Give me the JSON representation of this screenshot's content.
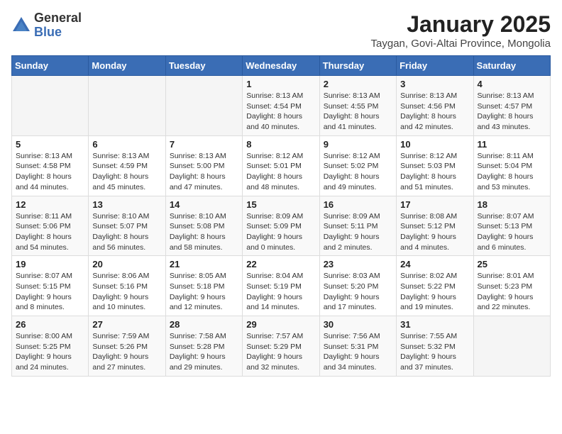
{
  "header": {
    "logo": {
      "line1": "General",
      "line2": "Blue"
    },
    "title": "January 2025",
    "subtitle": "Taygan, Govi-Altai Province, Mongolia"
  },
  "weekdays": [
    "Sunday",
    "Monday",
    "Tuesday",
    "Wednesday",
    "Thursday",
    "Friday",
    "Saturday"
  ],
  "weeks": [
    [
      {
        "day": "",
        "info": ""
      },
      {
        "day": "",
        "info": ""
      },
      {
        "day": "",
        "info": ""
      },
      {
        "day": "1",
        "info": "Sunrise: 8:13 AM\nSunset: 4:54 PM\nDaylight: 8 hours\nand 40 minutes."
      },
      {
        "day": "2",
        "info": "Sunrise: 8:13 AM\nSunset: 4:55 PM\nDaylight: 8 hours\nand 41 minutes."
      },
      {
        "day": "3",
        "info": "Sunrise: 8:13 AM\nSunset: 4:56 PM\nDaylight: 8 hours\nand 42 minutes."
      },
      {
        "day": "4",
        "info": "Sunrise: 8:13 AM\nSunset: 4:57 PM\nDaylight: 8 hours\nand 43 minutes."
      }
    ],
    [
      {
        "day": "5",
        "info": "Sunrise: 8:13 AM\nSunset: 4:58 PM\nDaylight: 8 hours\nand 44 minutes."
      },
      {
        "day": "6",
        "info": "Sunrise: 8:13 AM\nSunset: 4:59 PM\nDaylight: 8 hours\nand 45 minutes."
      },
      {
        "day": "7",
        "info": "Sunrise: 8:13 AM\nSunset: 5:00 PM\nDaylight: 8 hours\nand 47 minutes."
      },
      {
        "day": "8",
        "info": "Sunrise: 8:12 AM\nSunset: 5:01 PM\nDaylight: 8 hours\nand 48 minutes."
      },
      {
        "day": "9",
        "info": "Sunrise: 8:12 AM\nSunset: 5:02 PM\nDaylight: 8 hours\nand 49 minutes."
      },
      {
        "day": "10",
        "info": "Sunrise: 8:12 AM\nSunset: 5:03 PM\nDaylight: 8 hours\nand 51 minutes."
      },
      {
        "day": "11",
        "info": "Sunrise: 8:11 AM\nSunset: 5:04 PM\nDaylight: 8 hours\nand 53 minutes."
      }
    ],
    [
      {
        "day": "12",
        "info": "Sunrise: 8:11 AM\nSunset: 5:06 PM\nDaylight: 8 hours\nand 54 minutes."
      },
      {
        "day": "13",
        "info": "Sunrise: 8:10 AM\nSunset: 5:07 PM\nDaylight: 8 hours\nand 56 minutes."
      },
      {
        "day": "14",
        "info": "Sunrise: 8:10 AM\nSunset: 5:08 PM\nDaylight: 8 hours\nand 58 minutes."
      },
      {
        "day": "15",
        "info": "Sunrise: 8:09 AM\nSunset: 5:09 PM\nDaylight: 9 hours\nand 0 minutes."
      },
      {
        "day": "16",
        "info": "Sunrise: 8:09 AM\nSunset: 5:11 PM\nDaylight: 9 hours\nand 2 minutes."
      },
      {
        "day": "17",
        "info": "Sunrise: 8:08 AM\nSunset: 5:12 PM\nDaylight: 9 hours\nand 4 minutes."
      },
      {
        "day": "18",
        "info": "Sunrise: 8:07 AM\nSunset: 5:13 PM\nDaylight: 9 hours\nand 6 minutes."
      }
    ],
    [
      {
        "day": "19",
        "info": "Sunrise: 8:07 AM\nSunset: 5:15 PM\nDaylight: 9 hours\nand 8 minutes."
      },
      {
        "day": "20",
        "info": "Sunrise: 8:06 AM\nSunset: 5:16 PM\nDaylight: 9 hours\nand 10 minutes."
      },
      {
        "day": "21",
        "info": "Sunrise: 8:05 AM\nSunset: 5:18 PM\nDaylight: 9 hours\nand 12 minutes."
      },
      {
        "day": "22",
        "info": "Sunrise: 8:04 AM\nSunset: 5:19 PM\nDaylight: 9 hours\nand 14 minutes."
      },
      {
        "day": "23",
        "info": "Sunrise: 8:03 AM\nSunset: 5:20 PM\nDaylight: 9 hours\nand 17 minutes."
      },
      {
        "day": "24",
        "info": "Sunrise: 8:02 AM\nSunset: 5:22 PM\nDaylight: 9 hours\nand 19 minutes."
      },
      {
        "day": "25",
        "info": "Sunrise: 8:01 AM\nSunset: 5:23 PM\nDaylight: 9 hours\nand 22 minutes."
      }
    ],
    [
      {
        "day": "26",
        "info": "Sunrise: 8:00 AM\nSunset: 5:25 PM\nDaylight: 9 hours\nand 24 minutes."
      },
      {
        "day": "27",
        "info": "Sunrise: 7:59 AM\nSunset: 5:26 PM\nDaylight: 9 hours\nand 27 minutes."
      },
      {
        "day": "28",
        "info": "Sunrise: 7:58 AM\nSunset: 5:28 PM\nDaylight: 9 hours\nand 29 minutes."
      },
      {
        "day": "29",
        "info": "Sunrise: 7:57 AM\nSunset: 5:29 PM\nDaylight: 9 hours\nand 32 minutes."
      },
      {
        "day": "30",
        "info": "Sunrise: 7:56 AM\nSunset: 5:31 PM\nDaylight: 9 hours\nand 34 minutes."
      },
      {
        "day": "31",
        "info": "Sunrise: 7:55 AM\nSunset: 5:32 PM\nDaylight: 9 hours\nand 37 minutes."
      },
      {
        "day": "",
        "info": ""
      }
    ]
  ]
}
